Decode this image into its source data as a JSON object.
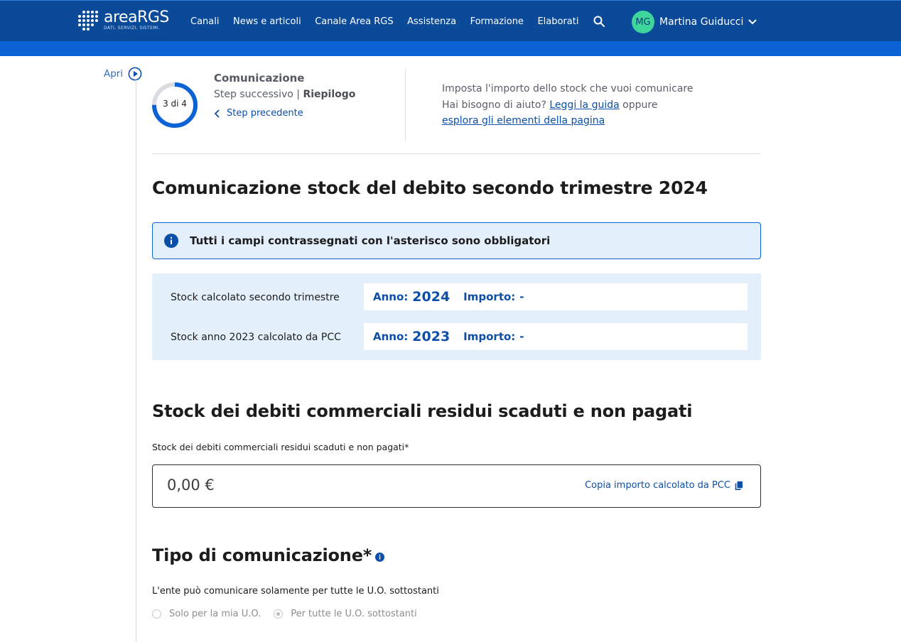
{
  "header": {
    "logo_word": "areaRGS",
    "logo_tagline": "DATI, SERVIZI, SISTEMI.",
    "nav": [
      "Canali",
      "News e articoli",
      "Canale Area RGS",
      "Assistenza",
      "Formazione",
      "Elaborati"
    ],
    "user": {
      "initials": "MG",
      "name": "Martina Guiducci"
    }
  },
  "sidebar": {
    "open_label": "Apri"
  },
  "stepper": {
    "progress": "3 di 4",
    "current": 3,
    "total": 4,
    "title": "Comunicazione",
    "next_prefix": "Step successivo |",
    "next_name": "Riepilogo",
    "prev_label": "Step precedente"
  },
  "help": {
    "line1": "Imposta l'importo dello stock che vuoi comunicare",
    "line2_prefix": "Hai bisogno di aiuto?",
    "guide_link": "Leggi la guida",
    "line2_suffix": "oppure",
    "explore_link": "esplora gli elementi della pagina"
  },
  "page_title": "Comunicazione stock del debito secondo trimestre 2024",
  "alert": {
    "text": "Tutti i campi contrassegnati con l'asterisco sono obbligatori"
  },
  "stock_rows": [
    {
      "label": "Stock calcolato secondo trimestre",
      "year_label": "Anno:",
      "year": "2024",
      "amount_label": "Importo:",
      "amount": "-"
    },
    {
      "label": "Stock anno 2023 calcolato da PCC",
      "year_label": "Anno:",
      "year": "2023",
      "amount_label": "Importo:",
      "amount": "-"
    }
  ],
  "debt_section": {
    "title": "Stock dei debiti commerciali residui scaduti e non pagati",
    "field_label": "Stock dei debiti commerciali residui scaduti e non pagati*",
    "value": "0,00 €",
    "copy_label": "Copia importo calcolato da PCC"
  },
  "communication_type": {
    "title": "Tipo di comunicazione*",
    "note": "L'ente può comunicare solamente per tutte le U.O. sottostanti",
    "options": [
      {
        "label": "Solo per la mia U.O.",
        "selected": false
      },
      {
        "label": "Per tutte le U.O. sottostanti",
        "selected": true
      }
    ]
  },
  "colors": {
    "header": "#0a4a99",
    "subbar": "#0c63d6",
    "accent": "#0c4fa8",
    "avatar": "#3fd69d",
    "info_bg": "#e3f0fc"
  }
}
